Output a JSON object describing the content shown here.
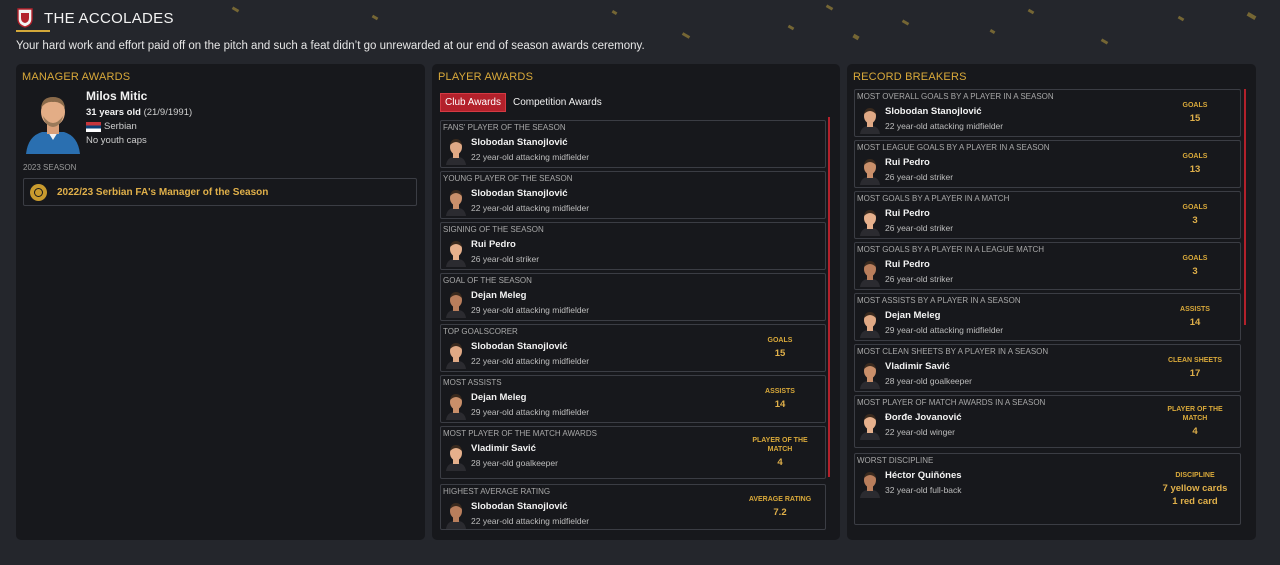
{
  "page": {
    "title": "THE ACCOLADES",
    "subtitle": "Your hard work and effort paid off on the pitch and such a feat didn’t go unrewarded at our end of season awards ceremony."
  },
  "manager": {
    "section_title": "MANAGER AWARDS",
    "name": "Milos Mitic",
    "age": "31 years old",
    "dob": "(21/9/1991)",
    "nationality": "Serbian",
    "youth_caps": "No youth caps",
    "season_label": "2023 SEASON",
    "award": "2022/23 Serbian FA's Manager of the Season"
  },
  "player_awards": {
    "section_title": "PLAYER AWARDS",
    "tabs": {
      "active": "Club Awards",
      "inactive": "Competition Awards"
    },
    "items": [
      {
        "heading": "FANS' PLAYER OF THE SEASON",
        "name": "Slobodan Stanojlović",
        "desc": "22 year-old attacking midfielder",
        "stat_label": "",
        "stat_value": ""
      },
      {
        "heading": "YOUNG PLAYER OF THE SEASON",
        "name": "Slobodan Stanojlović",
        "desc": "22 year-old attacking midfielder",
        "stat_label": "",
        "stat_value": ""
      },
      {
        "heading": "SIGNING OF THE SEASON",
        "name": "Rui Pedro",
        "desc": "26 year-old striker",
        "stat_label": "",
        "stat_value": ""
      },
      {
        "heading": "GOAL OF THE SEASON",
        "name": "Dejan Meleg",
        "desc": "29 year-old attacking midfielder",
        "stat_label": "",
        "stat_value": ""
      },
      {
        "heading": "TOP GOALSCORER",
        "name": "Slobodan Stanojlović",
        "desc": "22 year-old attacking midfielder",
        "stat_label": "GOALS",
        "stat_value": "15"
      },
      {
        "heading": "MOST ASSISTS",
        "name": "Dejan Meleg",
        "desc": "29 year-old attacking midfielder",
        "stat_label": "ASSISTS",
        "stat_value": "14"
      },
      {
        "heading": "MOST PLAYER OF THE MATCH AWARDS",
        "name": "Vladimir Savić",
        "desc": "28 year-old goalkeeper",
        "stat_label": "PLAYER OF THE MATCH",
        "stat_value": "4"
      },
      {
        "heading": "HIGHEST AVERAGE RATING",
        "name": "Slobodan Stanojlović",
        "desc": "22 year-old attacking midfielder",
        "stat_label": "AVERAGE RATING",
        "stat_value": "7.2"
      }
    ]
  },
  "record_breakers": {
    "section_title": "RECORD BREAKERS",
    "items": [
      {
        "heading": "MOST OVERALL GOALS BY A PLAYER IN A SEASON",
        "name": "Slobodan Stanojlović",
        "desc": "22 year-old attacking midfielder",
        "stat_label": "GOALS",
        "stat_value": "15"
      },
      {
        "heading": "MOST LEAGUE GOALS BY A PLAYER IN A SEASON",
        "name": "Rui Pedro",
        "desc": "26 year-old striker",
        "stat_label": "GOALS",
        "stat_value": "13"
      },
      {
        "heading": "MOST GOALS BY A PLAYER IN A MATCH",
        "name": "Rui Pedro",
        "desc": "26 year-old striker",
        "stat_label": "GOALS",
        "stat_value": "3"
      },
      {
        "heading": "MOST GOALS BY A PLAYER IN A LEAGUE MATCH",
        "name": "Rui Pedro",
        "desc": "26 year-old striker",
        "stat_label": "GOALS",
        "stat_value": "3"
      },
      {
        "heading": "MOST ASSISTS BY A PLAYER IN A SEASON",
        "name": "Dejan Meleg",
        "desc": "29 year-old attacking midfielder",
        "stat_label": "ASSISTS",
        "stat_value": "14"
      },
      {
        "heading": "MOST CLEAN SHEETS BY A PLAYER IN A SEASON",
        "name": "Vladimir Savić",
        "desc": "28 year-old goalkeeper",
        "stat_label": "CLEAN SHEETS",
        "stat_value": "17"
      },
      {
        "heading": "MOST PLAYER OF MATCH AWARDS IN A SEASON",
        "name": "Đorđe Jovanović",
        "desc": "22 year-old winger",
        "stat_label": "PLAYER OF THE MATCH",
        "stat_value": "4"
      },
      {
        "heading": "WORST DISCIPLINE",
        "name": "Héctor Quiñónes",
        "desc": "32 year-old full-back",
        "stat_label": "DISCIPLINE",
        "stat_value": "7 yellow cards\n1 red card"
      }
    ]
  },
  "colors": {
    "accent_gold": "#d9a93a",
    "active_tab_red": "#b3212b",
    "panel_bg": "#17181c",
    "page_bg": "#24262c"
  },
  "icons": {
    "club_badge": "club-crest-icon",
    "award": "medal-icon",
    "flag": "serbia-flag-icon"
  }
}
